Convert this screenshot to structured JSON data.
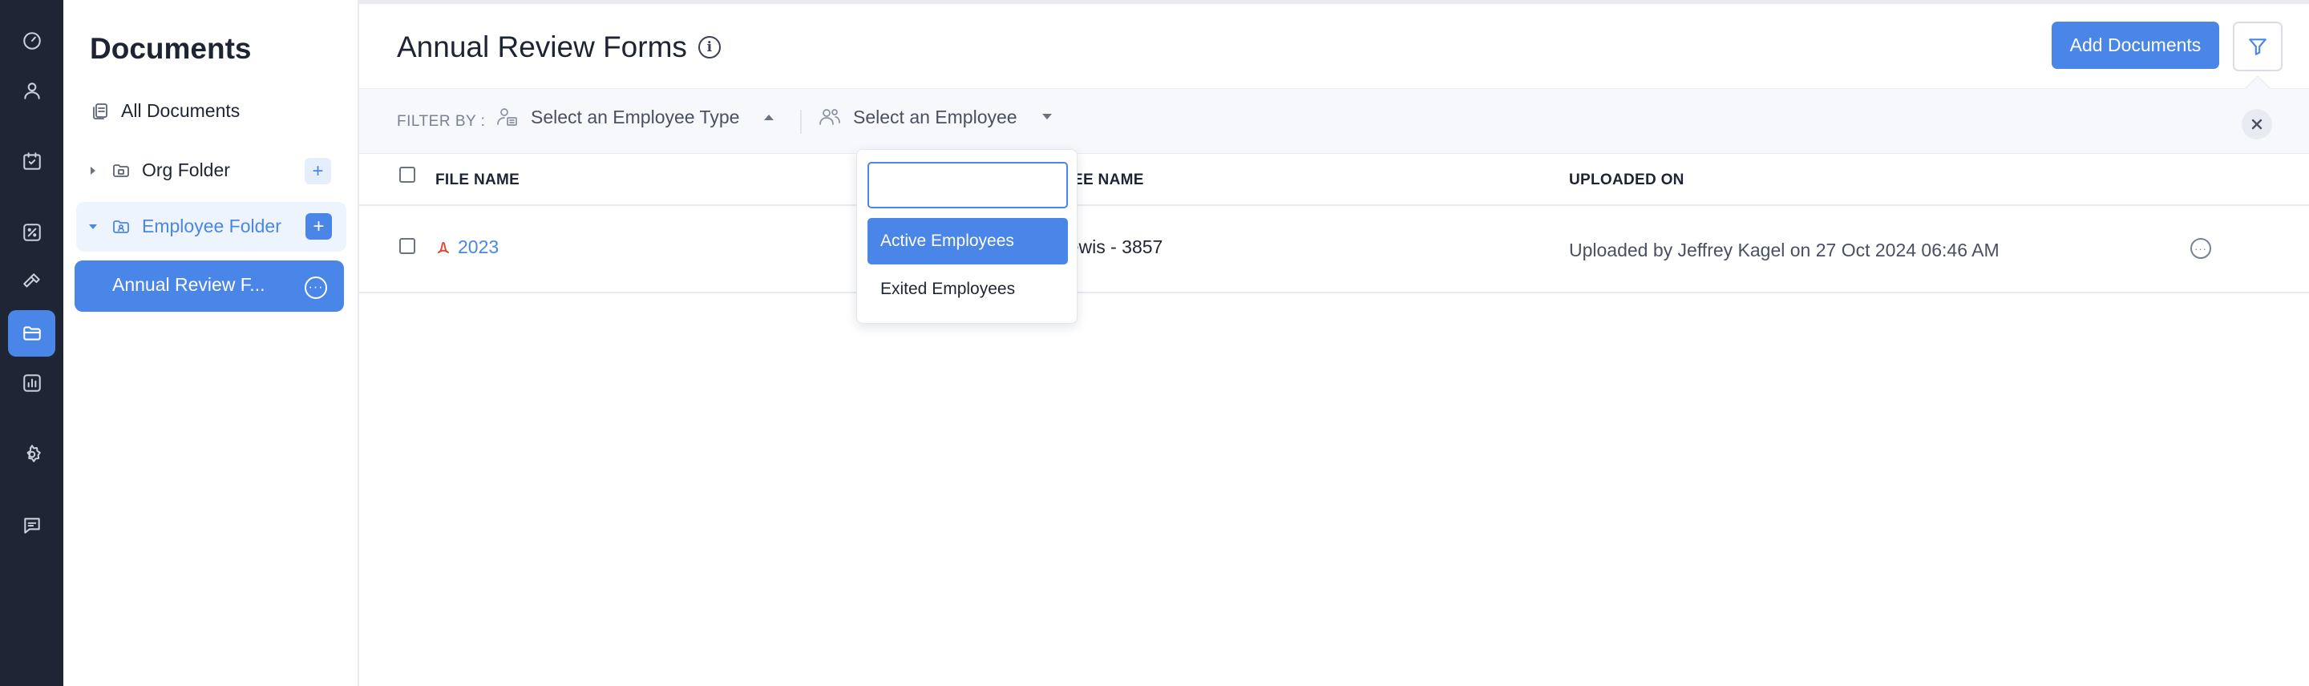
{
  "rail": {
    "items": [
      {
        "icon": "dashboard-icon"
      },
      {
        "icon": "user-icon"
      },
      {
        "icon": "calendar-icon"
      },
      {
        "icon": "discount-icon"
      },
      {
        "icon": "tools-icon"
      },
      {
        "icon": "folder-icon",
        "active": true
      },
      {
        "icon": "reports-icon"
      },
      {
        "icon": "settings-icon"
      },
      {
        "icon": "chat-icon"
      }
    ]
  },
  "docs": {
    "title": "Documents",
    "all_documents": "All Documents",
    "org_folder": "Org Folder",
    "employee_folder": "Employee Folder",
    "annual_item": "Annual Review F..."
  },
  "header": {
    "title": "Annual Review Forms",
    "add_button": "Add Documents"
  },
  "filter": {
    "label": "FILTER BY :",
    "employee_type_placeholder": "Select an Employee Type",
    "employee_placeholder": "Select an Employee"
  },
  "dropdown": {
    "search_value": "",
    "options": [
      "Active Employees",
      "Exited Employees"
    ]
  },
  "table": {
    "columns": [
      "FILE NAME",
      "EMPLOYEE NAME",
      "UPLOADED ON"
    ],
    "rows": [
      {
        "file_name": "2023",
        "employee_name": "Fiona Lewis - 3857",
        "uploaded_on": "Uploaded by Jeffrey Kagel on 27 Oct 2024 06:46 AM"
      }
    ]
  },
  "colors": {
    "accent": "#4a86e8",
    "rail_bg": "#1f2534",
    "pdf_red": "#e04a3a"
  }
}
